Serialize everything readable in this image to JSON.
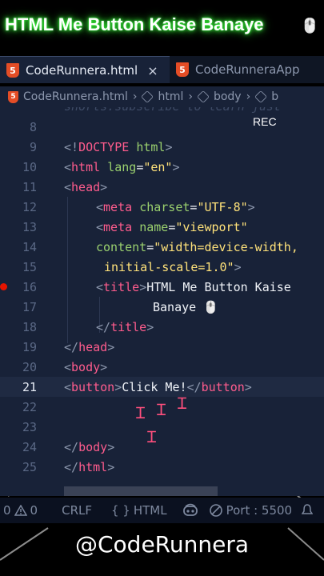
{
  "title": {
    "text": "HTML Me Button Kaise Banaye",
    "emoji": "🖱️"
  },
  "tabs": [
    {
      "label": "CodeRunnera.html",
      "active": true,
      "icon": "html5-icon",
      "close": "×"
    },
    {
      "label": "CodeRunneraApp",
      "active": false,
      "icon": "html5-icon"
    }
  ],
  "breadcrumb": {
    "file": "CodeRunnera.html",
    "items": [
      "html",
      "body",
      "b"
    ],
    "separator": "›"
  },
  "editor": {
    "ghost_text": "shorts:subscribe to learn just",
    "rec_label": "REC"
  },
  "lines": [
    {
      "n": "8"
    },
    {
      "n": "9"
    },
    {
      "n": "10"
    },
    {
      "n": "11"
    },
    {
      "n": "12"
    },
    {
      "n": "13"
    },
    {
      "n": "14"
    },
    {
      "n": "15"
    },
    {
      "n": "16"
    },
    {
      "n": "17"
    },
    {
      "n": "18"
    },
    {
      "n": "19"
    },
    {
      "n": "20"
    },
    {
      "n": "21"
    },
    {
      "n": "22"
    },
    {
      "n": "23"
    },
    {
      "n": "24"
    },
    {
      "n": "25"
    }
  ],
  "code": {
    "l9": {
      "p1": "<!",
      "tag": "DOCTYPE",
      "p2": " ",
      "attr": "html",
      "p3": ">"
    },
    "l10": {
      "p1": "<",
      "tag": "html",
      "sp": " ",
      "attr": "lang",
      "eq": "=",
      "str": "\"en\"",
      "p2": ">"
    },
    "l11": {
      "p1": "<",
      "tag": "head",
      "p2": ">"
    },
    "l12": {
      "p1": "<",
      "tag": "meta",
      "sp": " ",
      "attr": "charset",
      "eq": "=",
      "str": "\"UTF-8\"",
      "p2": ">"
    },
    "l13": {
      "p1": "<",
      "tag": "meta",
      "sp": " ",
      "attr": "name",
      "eq": "=",
      "str": "\"viewport\""
    },
    "l14": {
      "attr": "content",
      "eq": "=",
      "str": "\"width=device-width,"
    },
    "l15": {
      "str": "initial-scale=1.0\"",
      "p2": ">"
    },
    "l16": {
      "p1": "<",
      "tag": "title",
      "p2": ">",
      "txt": "HTML Me Button Kaise"
    },
    "l17": {
      "txt": "Banaye 🖱️"
    },
    "l18": {
      "p1": "</",
      "tag": "title",
      "p2": ">"
    },
    "l19": {
      "p1": "</",
      "tag": "head",
      "p2": ">"
    },
    "l20": {
      "p1": "<",
      "tag": "body",
      "p2": ">"
    },
    "l21": {
      "p1": "<",
      "tag": "button",
      "p2": ">",
      "txt": "Click Me!",
      "p3": "</",
      "tag2": "button",
      "p4": ">"
    },
    "l24": {
      "p1": "</",
      "tag": "body",
      "p2": ">"
    },
    "l25": {
      "p1": "</",
      "tag": "html",
      "p2": ">"
    }
  },
  "statusbar": {
    "errors": "0",
    "warnings": "0",
    "eol": "CRLF",
    "braces": "{ }",
    "language": "HTML",
    "port": "Port : 5500"
  },
  "handle": "@CodeRunnera",
  "colors": {
    "accent_green": "#3cff3c",
    "tag": "#ff5c8d",
    "attr": "#9ad06e",
    "string": "#ffe27a",
    "html5": "#e44d26"
  }
}
